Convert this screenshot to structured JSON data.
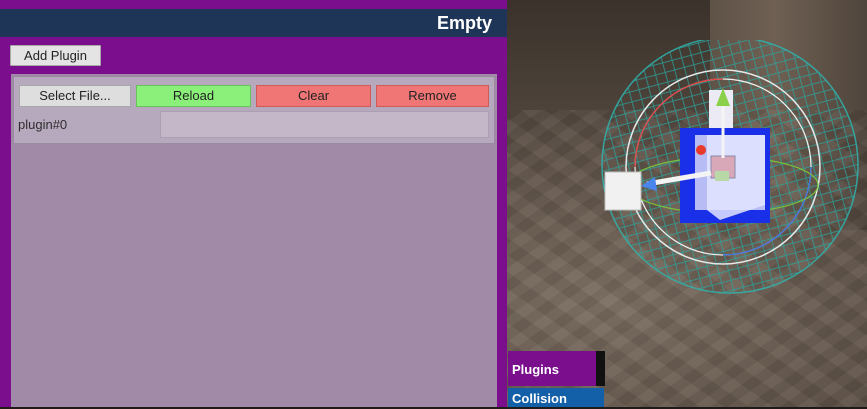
{
  "panel": {
    "title": "Empty",
    "add_plugin_label": "Add Plugin",
    "plugin_row": {
      "select_file_label": "Select File...",
      "reload_label": "Reload",
      "clear_label": "Clear",
      "remove_label": "Remove",
      "name": "plugin#0",
      "path_value": ""
    }
  },
  "tabs": {
    "plugins_label": "Plugins",
    "collision_label": "Collision"
  },
  "colors": {
    "panel_bg": "#7a0e8d",
    "title_bg": "#1e3557",
    "reload": "#8bf07a",
    "danger": "#f07676",
    "collision_tab": "#1460a8"
  }
}
